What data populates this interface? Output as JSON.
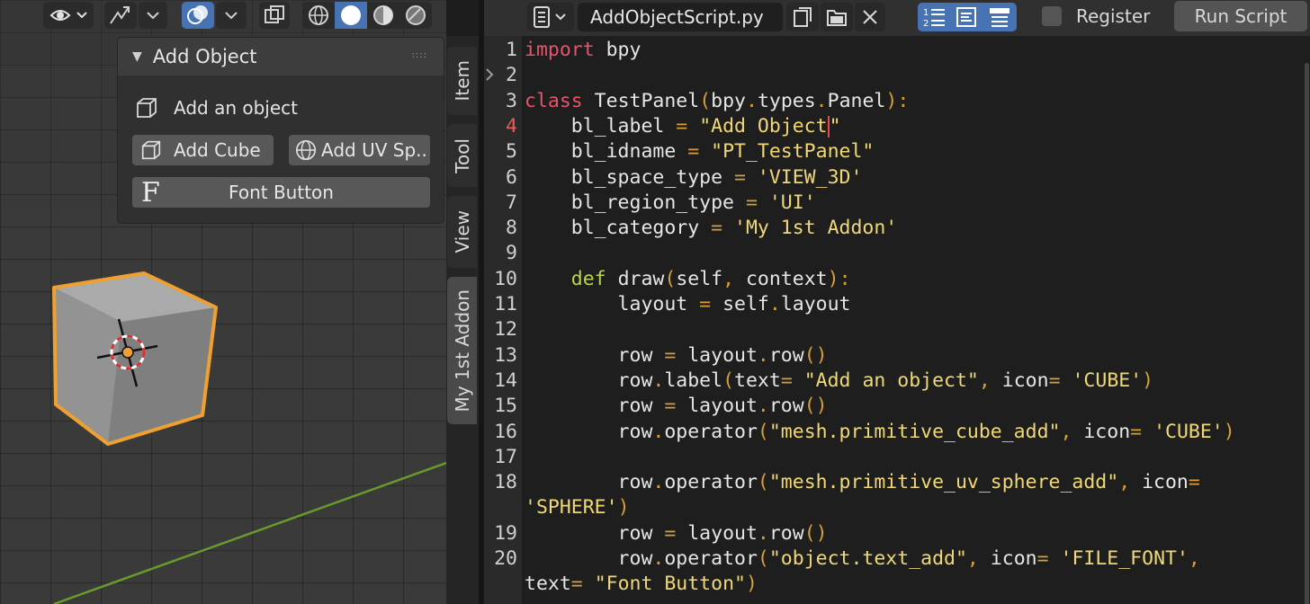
{
  "viewport": {
    "panel": {
      "title": "Add Object",
      "label_row": "Add an object",
      "buttons": {
        "add_cube": "Add Cube",
        "add_uv_sphere": "Add UV Sp..",
        "font_button": "Font Button"
      }
    },
    "sidebar_tabs": [
      "Item",
      "Tool",
      "View",
      "My 1st Addon"
    ],
    "active_tab": "My 1st Addon"
  },
  "editor": {
    "file_name": "AddObjectScript.py",
    "register_label": "Register",
    "run_script_label": "Run Script",
    "current_line": 4,
    "lines": [
      {
        "n": "1",
        "t": "import bpy"
      },
      {
        "n": "2",
        "t": ""
      },
      {
        "n": "3",
        "t": "class TestPanel(bpy.types.Panel):"
      },
      {
        "n": "4",
        "t": "    bl_label = \"Add Object\""
      },
      {
        "n": "5",
        "t": "    bl_idname = \"PT_TestPanel\""
      },
      {
        "n": "6",
        "t": "    bl_space_type = 'VIEW_3D'"
      },
      {
        "n": "7",
        "t": "    bl_region_type = 'UI'"
      },
      {
        "n": "8",
        "t": "    bl_category = 'My 1st Addon'"
      },
      {
        "n": "9",
        "t": ""
      },
      {
        "n": "10",
        "t": "    def draw(self, context):"
      },
      {
        "n": "11",
        "t": "        layout = self.layout"
      },
      {
        "n": "12",
        "t": ""
      },
      {
        "n": "13",
        "t": "        row = layout.row()"
      },
      {
        "n": "14",
        "t": "        row.label(text= \"Add an object\", icon= 'CUBE')"
      },
      {
        "n": "15",
        "t": "        row = layout.row()"
      },
      {
        "n": "16",
        "t": "        row.operator(\"mesh.primitive_cube_add\", icon= 'CUBE')"
      },
      {
        "n": "17",
        "t": ""
      },
      {
        "n": "18",
        "t": "        row.operator(\"mesh.primitive_uv_sphere_add\", icon="
      },
      {
        "n": "",
        "t": "'SPHERE')"
      },
      {
        "n": "19",
        "t": "        row = layout.row()"
      },
      {
        "n": "20",
        "t": "        row.operator(\"object.text_add\", icon= 'FILE_FONT',"
      },
      {
        "n": "",
        "t": "text= \"Font Button\")"
      }
    ]
  },
  "colors": {
    "active_blue": "#4772b3",
    "selection_orange": "#f0a030",
    "keyword": "#e8546b",
    "def_keyword": "#b6d64b",
    "string": "#f0d878"
  },
  "icons": {
    "header_left": [
      "visibility-icon",
      "gizmo-icon",
      "overlay-icon",
      "xray-icon",
      "wireframe-shading-icon",
      "solid-shading-icon",
      "material-shading-icon",
      "rendered-shading-icon"
    ],
    "header_right": [
      "text-menu-icon",
      "new-text-icon",
      "open-text-icon",
      "close-icon",
      "line-numbers-icon",
      "word-wrap-icon",
      "syntax-highlight-icon"
    ]
  }
}
